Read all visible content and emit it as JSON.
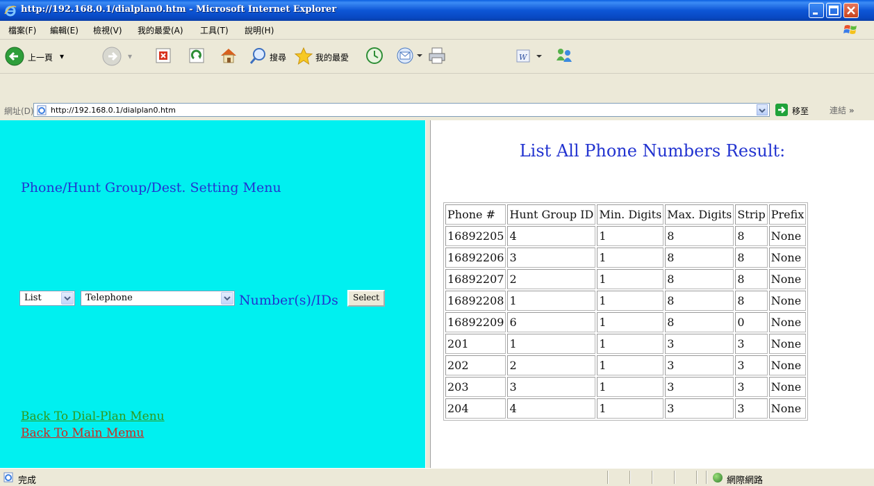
{
  "window": {
    "title": "http://192.168.0.1/dialplan0.htm - Microsoft Internet Explorer"
  },
  "menubar": {
    "items": [
      "檔案(F)",
      "編輯(E)",
      "檢視(V)",
      "我的最愛(A)",
      "工具(T)",
      "說明(H)"
    ]
  },
  "toolbar": {
    "back_label": "上一頁",
    "search_label": "搜尋",
    "favorites_label": "我的最愛"
  },
  "address": {
    "label": "網址(D)",
    "url": "http://192.168.0.1/dialplan0.htm",
    "go_label": "移至",
    "links_label": "連結"
  },
  "left": {
    "menu_title": "Phone/Hunt Group/Dest. Setting Menu",
    "action_select": "List",
    "type_select": "Telephone",
    "number_label": "Number(s)/IDs",
    "select_button": "Select",
    "link_dialplan": "Back To Dial-Plan Menu",
    "link_main": "Back To Main Memu"
  },
  "result": {
    "title": "List All Phone Numbers Result:",
    "headers": [
      "Phone #",
      "Hunt Group ID",
      "Min. Digits",
      "Max. Digits",
      "Strip",
      "Prefix"
    ],
    "rows": [
      [
        "16892205",
        "4",
        "1",
        "8",
        "8",
        "None"
      ],
      [
        "16892206",
        "3",
        "1",
        "8",
        "8",
        "None"
      ],
      [
        "16892207",
        "2",
        "1",
        "8",
        "8",
        "None"
      ],
      [
        "16892208",
        "1",
        "1",
        "8",
        "8",
        "None"
      ],
      [
        "16892209",
        "6",
        "1",
        "8",
        "0",
        "None"
      ],
      [
        "201",
        "1",
        "1",
        "3",
        "3",
        "None"
      ],
      [
        "202",
        "2",
        "1",
        "3",
        "3",
        "None"
      ],
      [
        "203",
        "3",
        "1",
        "3",
        "3",
        "None"
      ],
      [
        "204",
        "4",
        "1",
        "3",
        "3",
        "None"
      ]
    ]
  },
  "status": {
    "text": "完成",
    "zone": "網際網路"
  },
  "colors": {
    "left_frame_bg": "#00F0F0",
    "heading_blue": "#2233D0",
    "link_green": "#2E9A1E",
    "link_red": "#D0261E"
  }
}
